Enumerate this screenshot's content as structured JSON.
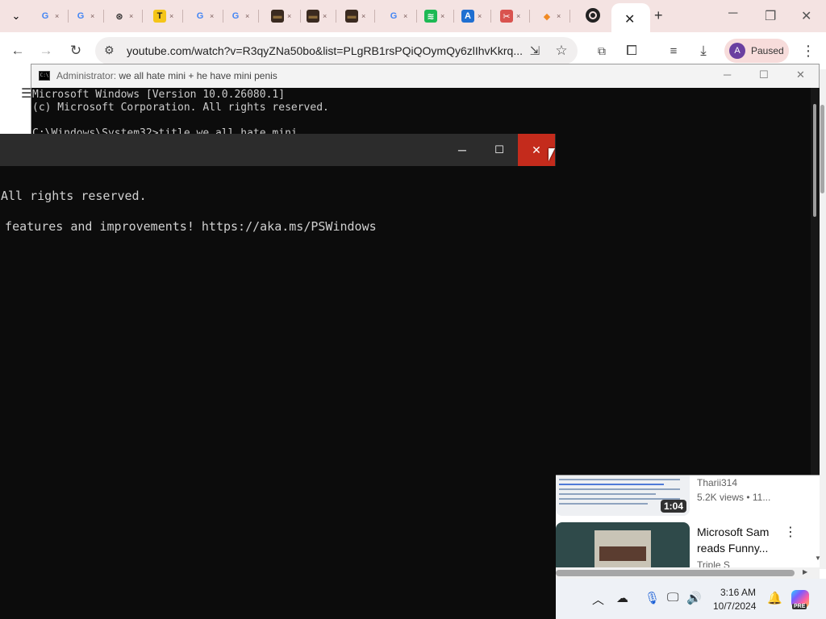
{
  "browser": {
    "tabs": [
      {
        "icon": "google-icon",
        "glyph": "G",
        "color": "#4285f4"
      },
      {
        "icon": "google-icon",
        "glyph": "G",
        "color": "#4285f4"
      },
      {
        "icon": "chatgpt-icon",
        "glyph": "⊛",
        "color": "#222222"
      },
      {
        "icon": "t-app-icon",
        "glyph": "T",
        "color": "#222222",
        "bg": "#f5c518"
      },
      {
        "icon": "google-icon",
        "glyph": "G",
        "color": "#4285f4"
      },
      {
        "icon": "google-icon",
        "glyph": "G",
        "color": "#4285f4"
      },
      {
        "icon": "dark-thumbnail-icon",
        "glyph": "▬",
        "color": "#8a6a3a",
        "bg": "#3a2a20"
      },
      {
        "icon": "dark-thumbnail-icon",
        "glyph": "▬",
        "color": "#8a6a3a",
        "bg": "#3a2a20"
      },
      {
        "icon": "dark-thumbnail-icon",
        "glyph": "▬",
        "color": "#8a6a3a",
        "bg": "#3a2a20"
      },
      {
        "icon": "google-icon",
        "glyph": "G",
        "color": "#4285f4"
      },
      {
        "icon": "spotify-icon",
        "glyph": "≋",
        "color": "#ffffff",
        "bg": "#1db954"
      },
      {
        "icon": "app-a-icon",
        "glyph": "A",
        "color": "#ffffff",
        "bg": "#1f6fd1"
      },
      {
        "icon": "tools-icon",
        "glyph": "✂",
        "color": "#ffffff",
        "bg": "#d9534f"
      },
      {
        "icon": "diamond-icon",
        "glyph": "◆",
        "color": "#f08a24"
      }
    ],
    "active_tab": {
      "icon": "github-icon",
      "glyph": "●"
    },
    "tab_close_glyph": "×",
    "active_close_glyph": "✕",
    "new_tab_glyph": "+",
    "url": "youtube.com/watch?v=R3qyZNa50bo&list=PLgRB1rsPQiQOymQy6zlIhvKkrq...",
    "profile_initial": "A",
    "profile_status": "Paused",
    "accent": "#f7dcdb"
  },
  "back_window": {
    "title_prefix": "Administrator:",
    "title_rest": " we all hate mini + he have mini penis",
    "lines": [
      "Microsoft Windows [Version 10.0.26080.1]",
      "(c) Microsoft Corporation. All rights reserved.",
      "C:\\Windows\\System32>title we all hate mini"
    ]
  },
  "front_window": {
    "lines": [
      "All rights reserved.",
      "  features and improvements! https://aka.ms/PSWindows"
    ],
    "close_color": "#c42b1c"
  },
  "youtube": {
    "video1": {
      "duration": "1:04",
      "channel": "Tharii314",
      "meta": "5.2K views • 11..."
    },
    "video2": {
      "title": "Microsoft Sam reads Funny...",
      "channel": "Triple S"
    }
  },
  "taskbar": {
    "time": "3:16 AM",
    "date": "10/7/2024",
    "copilot_badge": "PRE"
  }
}
